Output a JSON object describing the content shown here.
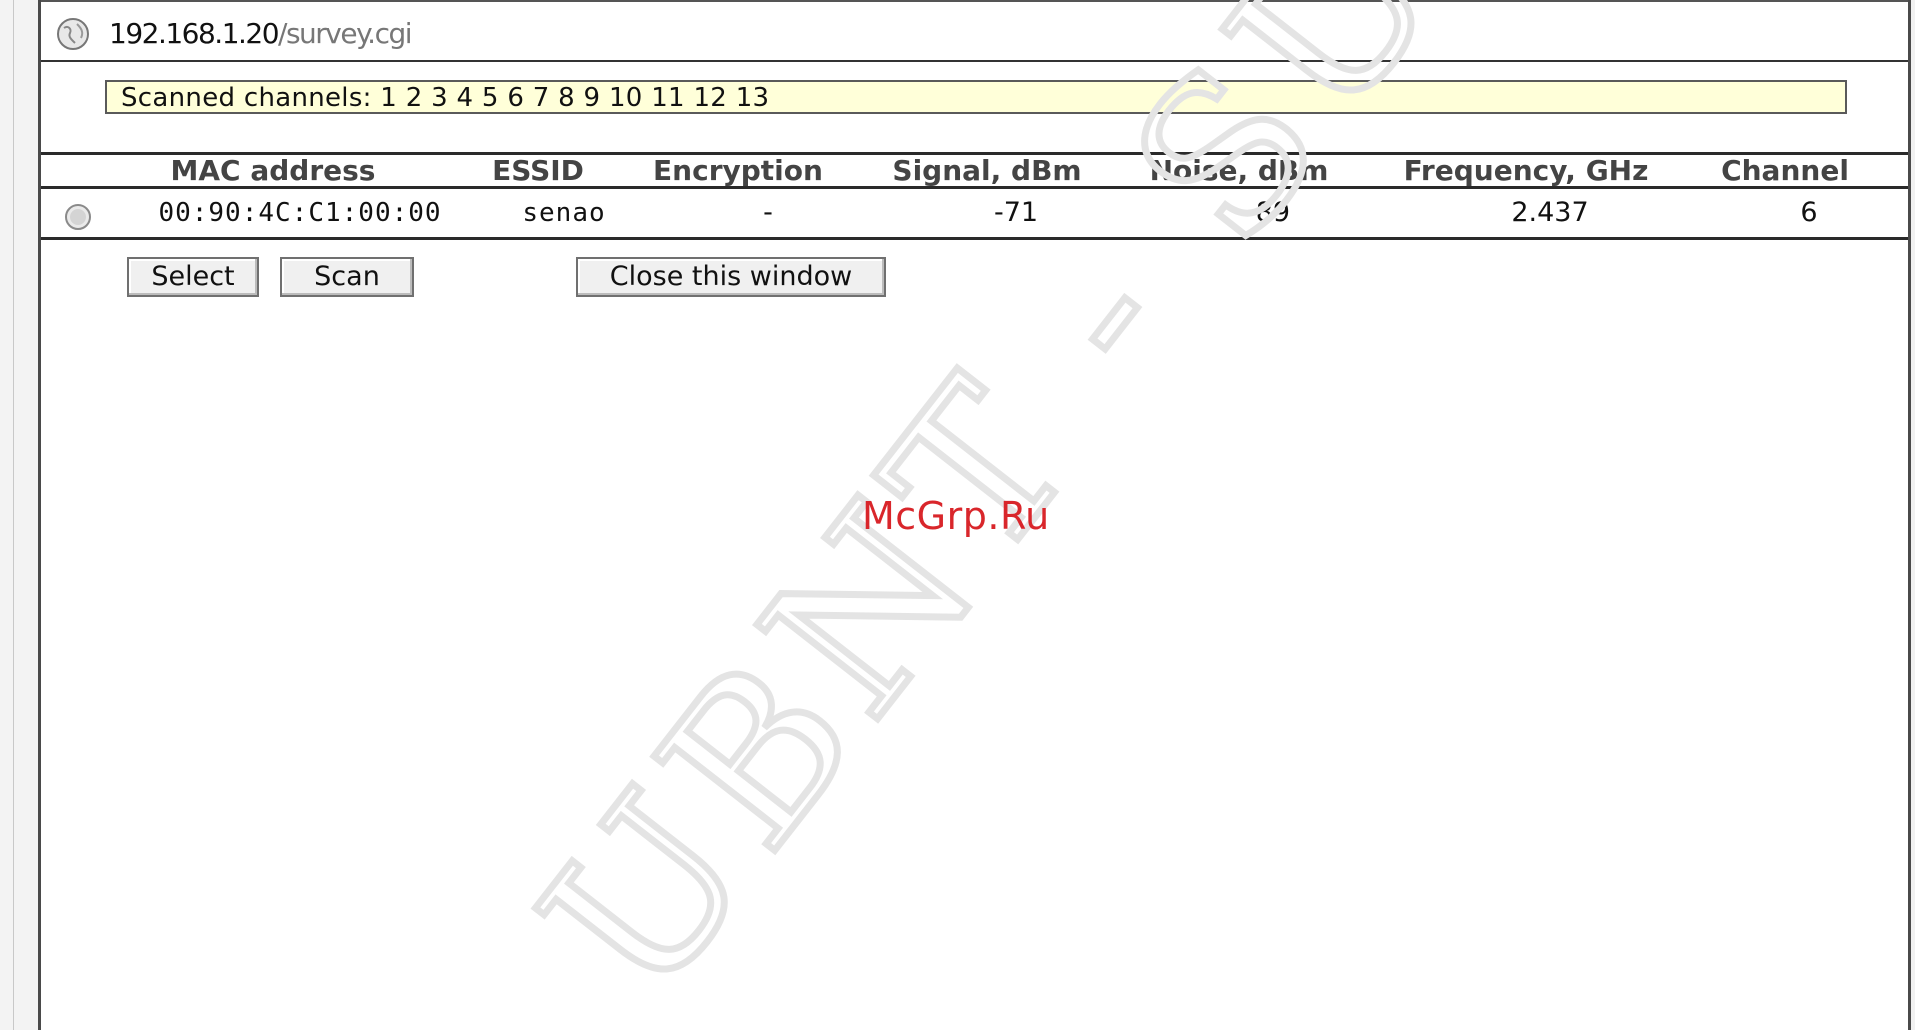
{
  "browser": {
    "url_host": "192.168.1.20",
    "url_path": "/survey.cgi"
  },
  "scan": {
    "scanned_channels_label": "Scanned channels: 1 2 3 4 5 6 7 8 9 10 11 12 13"
  },
  "table": {
    "headers": [
      "MAC address",
      "ESSID",
      "Encryption",
      "Signal, dBm",
      "Noise, dBm",
      "Frequency, GHz",
      "Channel"
    ],
    "rows": [
      {
        "selected": false,
        "mac": "00:90:4C:C1:00:00",
        "essid": "senao",
        "encryption": "-",
        "signal": "-71",
        "noise": "-89",
        "frequency": "2.437",
        "channel": "6"
      }
    ]
  },
  "buttons": {
    "select": "Select",
    "scan": "Scan",
    "close": "Close this window"
  },
  "watermarks": {
    "site": "McGrp.Ru",
    "diagonal": "UBNT - SU"
  },
  "colors": {
    "scanned_box_bg": "#ffffd9",
    "watermark_red": "#d9262b"
  },
  "icons": {
    "address_bar": "globe-icon",
    "row_select": "radio-button"
  }
}
